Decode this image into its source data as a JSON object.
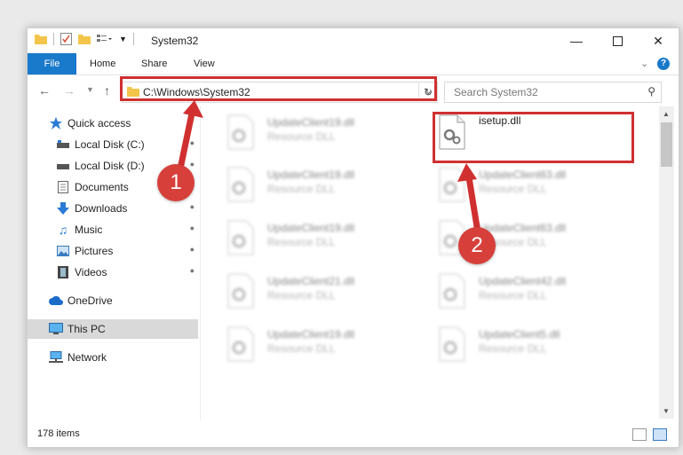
{
  "window": {
    "title": "System32"
  },
  "ribbon": {
    "tabs": [
      "File",
      "Home",
      "Share",
      "View"
    ],
    "help": "?"
  },
  "address": {
    "path": "C:\\Windows\\System32"
  },
  "search": {
    "placeholder": "Search System32"
  },
  "nav": {
    "items": [
      {
        "label": "Quick access",
        "icon": "star-icon",
        "pinned": false
      },
      {
        "label": "Local Disk (C:)",
        "icon": "drive-icon",
        "pinned": true
      },
      {
        "label": "Local Disk (D:)",
        "icon": "drive-icon",
        "pinned": true
      },
      {
        "label": "Documents",
        "icon": "documents-icon",
        "pinned": true
      },
      {
        "label": "Downloads",
        "icon": "download-icon",
        "pinned": true
      },
      {
        "label": "Music",
        "icon": "music-icon",
        "pinned": true
      },
      {
        "label": "Pictures",
        "icon": "pictures-icon",
        "pinned": true
      },
      {
        "label": "Videos",
        "icon": "videos-icon",
        "pinned": true
      },
      {
        "label": "OneDrive",
        "icon": "cloud-icon",
        "pinned": false
      },
      {
        "label": "This PC",
        "icon": "computer-icon",
        "pinned": false,
        "selected": true
      },
      {
        "label": "Network",
        "icon": "network-icon",
        "pinned": false
      }
    ]
  },
  "files": {
    "highlighted": {
      "name": "isetup.dll"
    },
    "items": [
      {
        "name": "UpdateClient19.dll",
        "type": "Resource DLL"
      },
      {
        "name": "UpdateClient19.dll",
        "type": "Resource DLL"
      },
      {
        "name": "UpdateClient63.dll",
        "type": "Resource DLL"
      },
      {
        "name": "UpdateClient19.dll",
        "type": "Resource DLL"
      },
      {
        "name": "UpdateClient63.dll",
        "type": "Resource DLL"
      },
      {
        "name": "UpdateClient21.dll",
        "type": "Resource DLL"
      },
      {
        "name": "UpdateClient42.dll",
        "type": "Resource DLL"
      },
      {
        "name": "UpdateClient19.dll",
        "type": "Resource DLL"
      },
      {
        "name": "UpdateClient5.dll",
        "type": "Resource DLL"
      }
    ]
  },
  "status": {
    "count": "178 items"
  },
  "annotations": {
    "step1": "1",
    "step2": "2",
    "color": "#d03030"
  }
}
